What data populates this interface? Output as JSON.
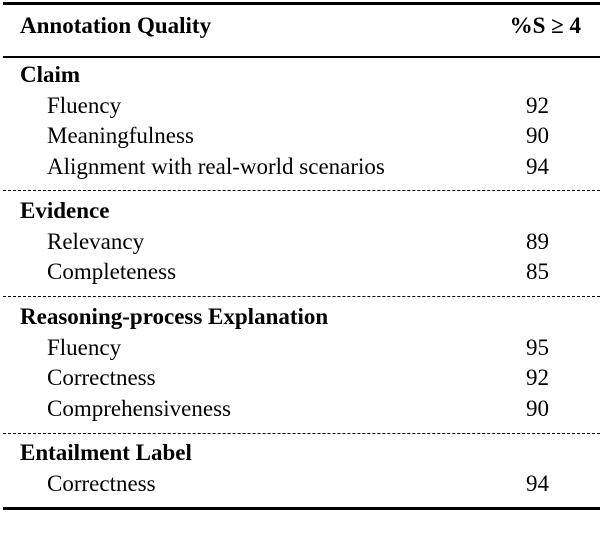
{
  "table": {
    "header": {
      "col1": "Annotation Quality",
      "col2": "%S ≥ 4"
    },
    "groups": [
      {
        "title": "Claim",
        "rows": [
          {
            "label": "Fluency",
            "value": "92"
          },
          {
            "label": "Meaningfulness",
            "value": "90"
          },
          {
            "label": "Alignment with real-world scenarios",
            "value": "94"
          }
        ]
      },
      {
        "title": "Evidence",
        "rows": [
          {
            "label": "Relevancy",
            "value": "89"
          },
          {
            "label": "Completeness",
            "value": "85"
          }
        ]
      },
      {
        "title": "Reasoning-process Explanation",
        "rows": [
          {
            "label": "Fluency",
            "value": "95"
          },
          {
            "label": "Correctness",
            "value": "92"
          },
          {
            "label": "Comprehensiveness",
            "value": "90"
          }
        ]
      },
      {
        "title": "Entailment Label",
        "rows": [
          {
            "label": "Correctness",
            "value": "94"
          }
        ]
      }
    ]
  }
}
